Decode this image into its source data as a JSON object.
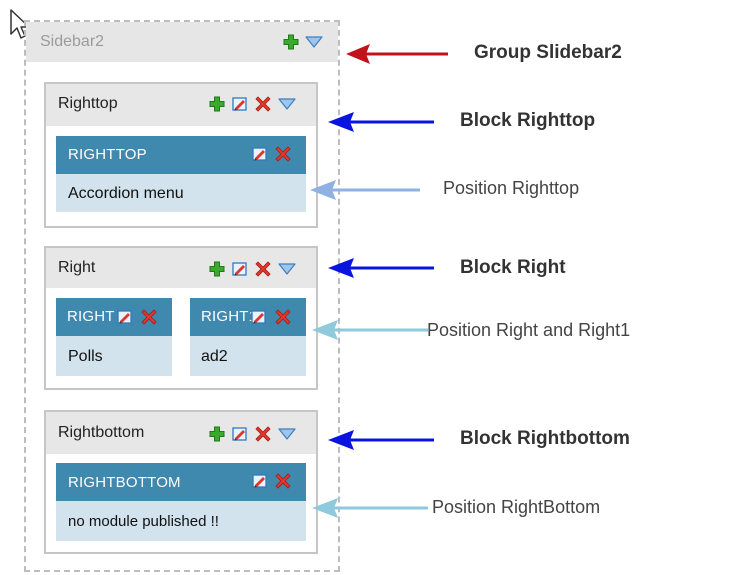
{
  "group": {
    "title": "Sidebar2",
    "icons": [
      "add-icon",
      "collapse-icon"
    ],
    "annotation": "Group Slidebar2"
  },
  "blocks": [
    {
      "title": "Righttop",
      "annotation": "Block Righttop",
      "positions": [
        {
          "title": "RIGHTTOP",
          "content": "Accordion menu"
        }
      ],
      "positions_annotation": "Position Righttop"
    },
    {
      "title": "Right",
      "annotation": "Block Right",
      "positions": [
        {
          "title": "RIGHT",
          "content": "Polls"
        },
        {
          "title": "RIGHT1",
          "content": "ad2"
        }
      ],
      "positions_annotation": "Position Right and Right1"
    },
    {
      "title": "Rightbottom",
      "annotation": "Block Rightbottom",
      "positions": [
        {
          "title": "RIGHTBOTTOM",
          "content": "no module published !!"
        }
      ],
      "positions_annotation": "Position RightBottom"
    }
  ],
  "colors": {
    "group_arrow": "#c0141a",
    "block_arrow": "#0a14e0",
    "position_arrow_1": "#8fb2e3",
    "position_arrow_2": "#8ecadb",
    "position_header": "#3f88ae",
    "position_body": "#d2e3ee"
  }
}
